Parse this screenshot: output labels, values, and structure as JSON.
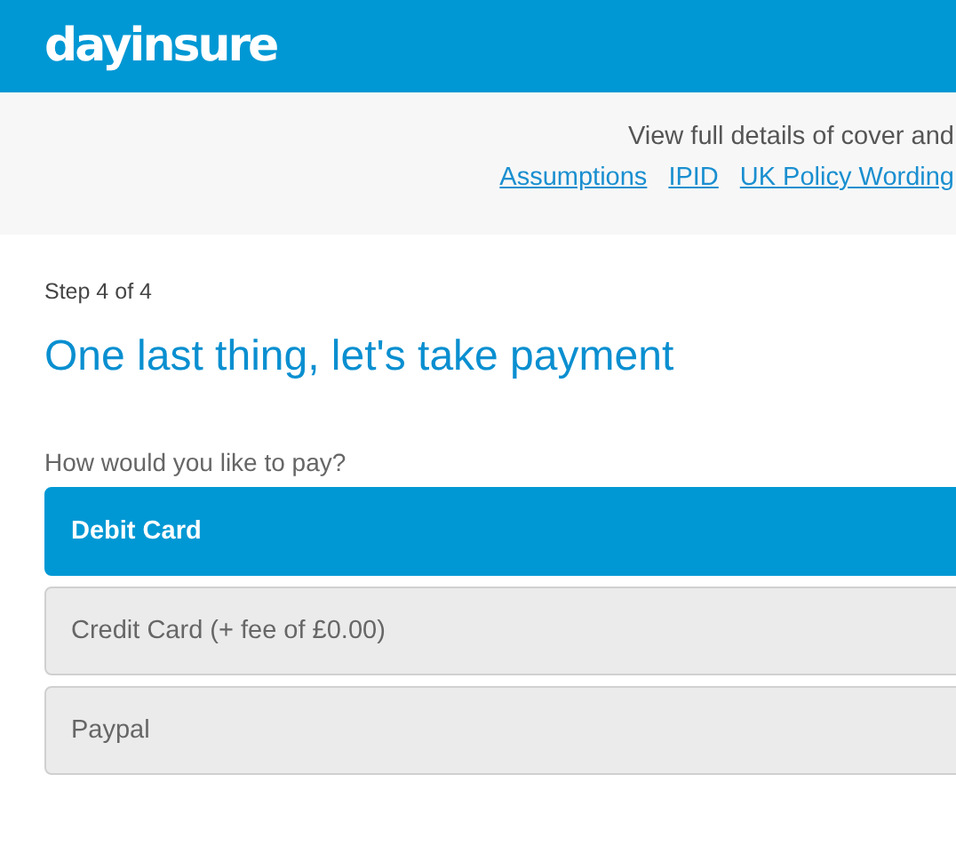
{
  "header": {
    "logo": "dayinsure"
  },
  "info": {
    "text": "View full details of cover and",
    "links": [
      "Assumptions",
      "IPID",
      "UK Policy Wording"
    ]
  },
  "step": "Step 4 of 4",
  "heading": "One last thing, let's take payment",
  "question": "How would you like to pay?",
  "options": [
    {
      "label": "Debit Card",
      "selected": true
    },
    {
      "label": "Credit Card (+ fee of £0.00)",
      "selected": false
    },
    {
      "label": "Paypal",
      "selected": false
    }
  ]
}
